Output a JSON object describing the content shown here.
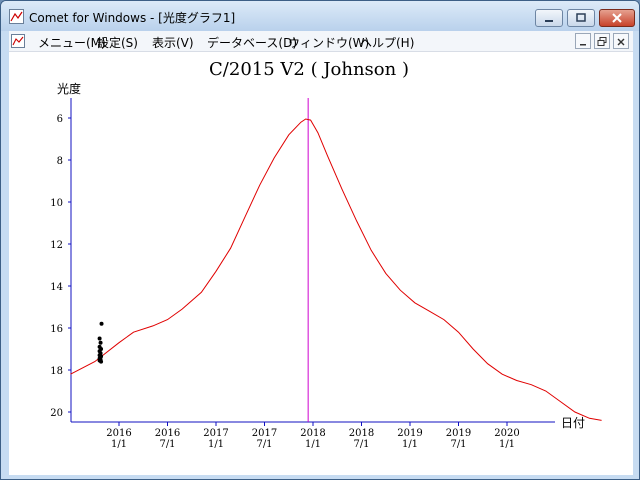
{
  "window": {
    "title": "Comet for Windows - [光度グラフ1]",
    "buttons": [
      "minimize",
      "maximize",
      "close"
    ]
  },
  "menubar": {
    "items": [
      {
        "label": "メニュー(M)"
      },
      {
        "label": "設定(S)"
      },
      {
        "label": "表示(V)"
      },
      {
        "label": "データベース(D)"
      },
      {
        "label": "ウィンドウ(W)"
      },
      {
        "label": "ヘルプ(H)"
      }
    ]
  },
  "chart_data": {
    "type": "line",
    "title": "C/2015 V2 ( Johnson )",
    "ylabel": "光度",
    "xlabel": "日付",
    "ylim": [
      20.5,
      5
    ],
    "y_ticks": [
      6,
      8,
      10,
      12,
      14,
      16,
      18,
      20
    ],
    "x_ticks": [
      {
        "year": "2016",
        "date": "1/1"
      },
      {
        "year": "2016",
        "date": "7/1"
      },
      {
        "year": "2017",
        "date": "1/1"
      },
      {
        "year": "2017",
        "date": "7/1"
      },
      {
        "year": "2018",
        "date": "1/1"
      },
      {
        "year": "2018",
        "date": "7/1"
      },
      {
        "year": "2019",
        "date": "1/1"
      },
      {
        "year": "2019",
        "date": "7/1"
      },
      {
        "year": "2020",
        "date": "1/1"
      }
    ],
    "x_index_note_units": "half-years since 2016 1/1",
    "xlim": [
      -1.0,
      8.95
    ],
    "current_date_marker": 3.9,
    "colors": {
      "curve": "#e00000",
      "marker": "#d000d0",
      "axis": "#1010c0",
      "obs": "#000000"
    },
    "series": [
      {
        "style": "predicted-curve",
        "points": [
          [
            -1.0,
            18.2
          ],
          [
            -0.5,
            17.6
          ],
          [
            0.0,
            16.7
          ],
          [
            0.3,
            16.2
          ],
          [
            0.7,
            15.9
          ],
          [
            1.0,
            15.6
          ],
          [
            1.3,
            15.1
          ],
          [
            1.7,
            14.3
          ],
          [
            2.0,
            13.3
          ],
          [
            2.3,
            12.2
          ],
          [
            2.6,
            10.7
          ],
          [
            2.9,
            9.2
          ],
          [
            3.2,
            7.9
          ],
          [
            3.5,
            6.8
          ],
          [
            3.75,
            6.2
          ],
          [
            3.85,
            6.05
          ],
          [
            3.95,
            6.1
          ],
          [
            4.1,
            6.7
          ],
          [
            4.3,
            7.8
          ],
          [
            4.6,
            9.4
          ],
          [
            4.9,
            10.9
          ],
          [
            5.2,
            12.3
          ],
          [
            5.5,
            13.4
          ],
          [
            5.8,
            14.2
          ],
          [
            6.1,
            14.8
          ],
          [
            6.4,
            15.2
          ],
          [
            6.7,
            15.6
          ],
          [
            7.0,
            16.2
          ],
          [
            7.3,
            17.0
          ],
          [
            7.6,
            17.7
          ],
          [
            7.9,
            18.2
          ],
          [
            8.2,
            18.5
          ],
          [
            8.5,
            18.7
          ],
          [
            8.8,
            19.0
          ],
          [
            9.1,
            19.5
          ],
          [
            9.4,
            20.0
          ],
          [
            9.7,
            20.3
          ],
          [
            9.95,
            20.4
          ]
        ]
      },
      {
        "style": "observations",
        "points": [
          [
            -0.36,
            15.8
          ],
          [
            -0.4,
            16.5
          ],
          [
            -0.38,
            16.7
          ],
          [
            -0.4,
            16.9
          ],
          [
            -0.37,
            17.0
          ],
          [
            -0.4,
            17.1
          ],
          [
            -0.38,
            17.2
          ],
          [
            -0.4,
            17.3
          ],
          [
            -0.37,
            17.35
          ],
          [
            -0.4,
            17.45
          ],
          [
            -0.38,
            17.5
          ],
          [
            -0.4,
            17.55
          ],
          [
            -0.37,
            17.6
          ]
        ]
      }
    ]
  }
}
